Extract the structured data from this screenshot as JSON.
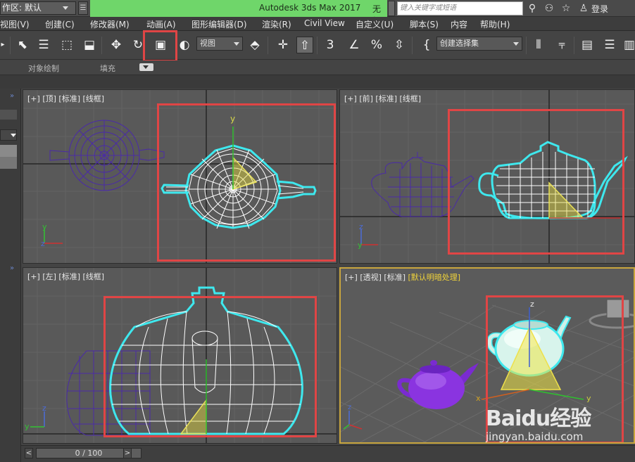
{
  "titlebar": {
    "workspace_label": "作区: 默认",
    "app_title": "Autodesk 3ds Max 2017",
    "doc_title": "无标题",
    "search_placeholder": "键入关键字或短语",
    "login_label": "登录",
    "accent_color": "#6fd66a"
  },
  "menubar": {
    "items": [
      "视图(V)",
      "创建(C)",
      "修改器(M)",
      "动画(A)",
      "图形编辑器(D)",
      "渲染(R)",
      "Civil View",
      "自定义(U)",
      "脚本(S)",
      "内容",
      "帮助(H)"
    ]
  },
  "toolbar": {
    "view_dropdown": "视图",
    "selection_set_dropdown": "创建选择集",
    "highlight_color": "#e04545"
  },
  "ribbon": {
    "tab1": "对象绘制",
    "tab2": "填充"
  },
  "viewports": {
    "top": {
      "plus": "[+]",
      "view": "[顶]",
      "mode": "[标准]",
      "shading": "[线框]"
    },
    "front": {
      "plus": "[+]",
      "view": "[前]",
      "mode": "[标准]",
      "shading": "[线框]"
    },
    "left": {
      "plus": "[+]",
      "view": "[左]",
      "mode": "[标准]",
      "shading": "[线框]"
    },
    "perspective": {
      "plus": "[+]",
      "view": "[透视]",
      "mode": "[标准]",
      "shading": "[默认明暗处理]"
    }
  },
  "axes": {
    "x": "x",
    "y": "y",
    "z": "z"
  },
  "timeline": {
    "frame": "0 / 100",
    "prev": "<",
    "next": ">"
  },
  "watermark": {
    "brand": "Baidu经验",
    "url": "jingyan.baidu.com"
  }
}
